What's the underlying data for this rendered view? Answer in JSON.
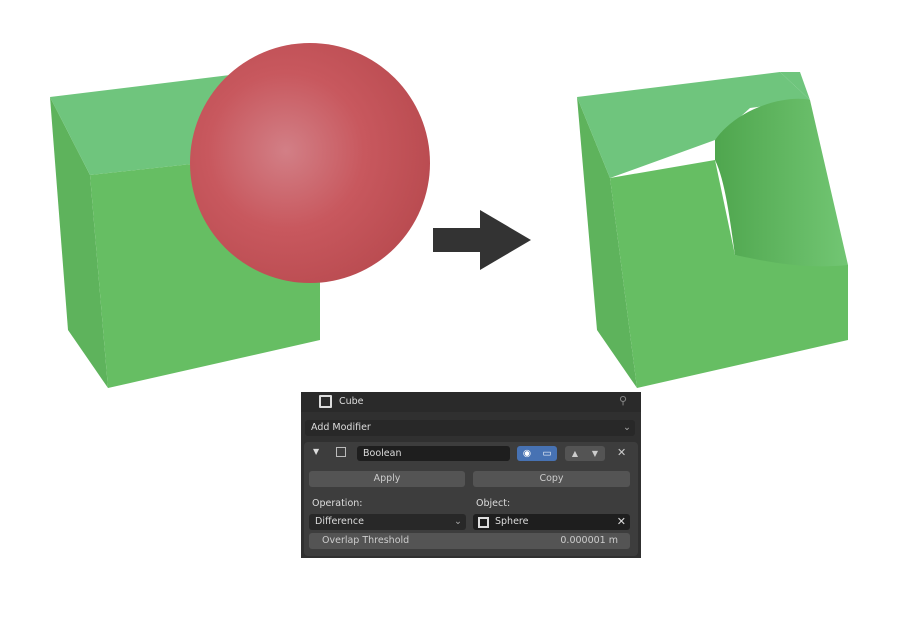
{
  "header": {
    "object_name": "Cube",
    "object_icon": "object-icon",
    "pin_icon": "pin-icon"
  },
  "add_modifier": {
    "label": "Add Modifier"
  },
  "modifier": {
    "name": "Boolean",
    "apply_label": "Apply",
    "copy_label": "Copy",
    "operation_label": "Operation:",
    "operation_value": "Difference",
    "object_label": "Object:",
    "object_value": "Sphere",
    "overlap_label": "Overlap Threshold",
    "overlap_value": "0.000001 m",
    "render_toggle_on": true,
    "viewport_toggle_on": true
  },
  "colors": {
    "accent": "#4772b3",
    "cube": "#6cbf6a",
    "sphere": "#c4555a",
    "arrow": "#333333"
  }
}
